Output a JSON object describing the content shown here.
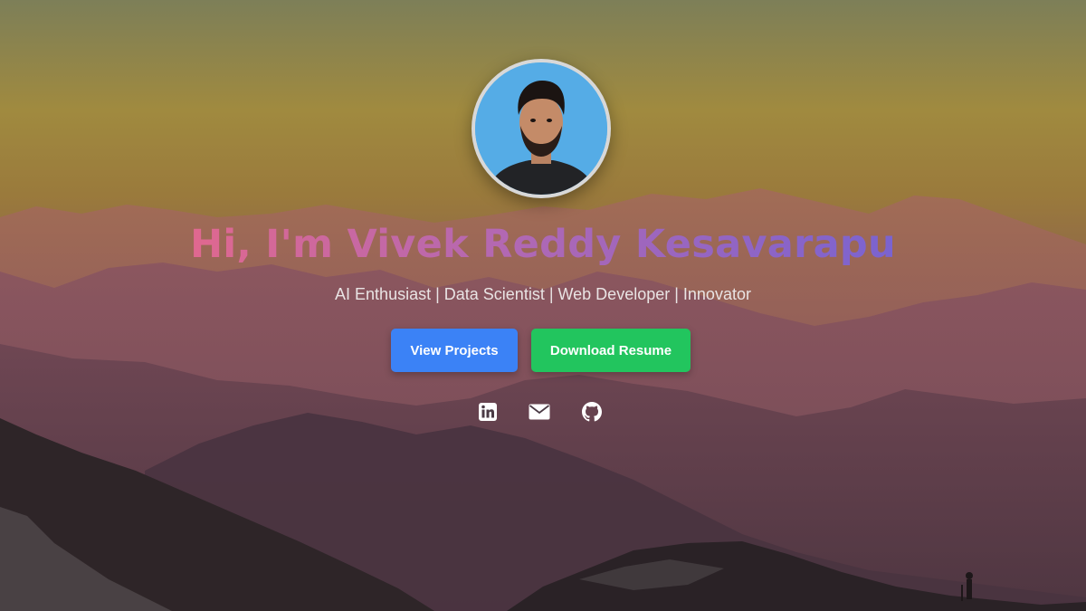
{
  "hero": {
    "greeting": "Hi, I'm Vivek Reddy Kesavarapu",
    "tagline": "AI Enthusiast | Data Scientist | Web Developer | Innovator",
    "title_gradient": [
      "#e0688f",
      "#7a63d0"
    ]
  },
  "buttons": {
    "view_projects": "View Projects",
    "download_resume": "Download Resume",
    "colors": {
      "view_projects": "#3b82f6",
      "download_resume": "#22c55e"
    }
  },
  "social": [
    {
      "icon": "linkedin-icon"
    },
    {
      "icon": "mail-icon"
    },
    {
      "icon": "github-icon"
    }
  ],
  "colors": {
    "sky_top": "#8a8a55",
    "sky_mid": "#b89433",
    "mountain_far": "#8c5a58",
    "mountain_near": "#2e2424",
    "avatar_bg": "#55ace6"
  }
}
